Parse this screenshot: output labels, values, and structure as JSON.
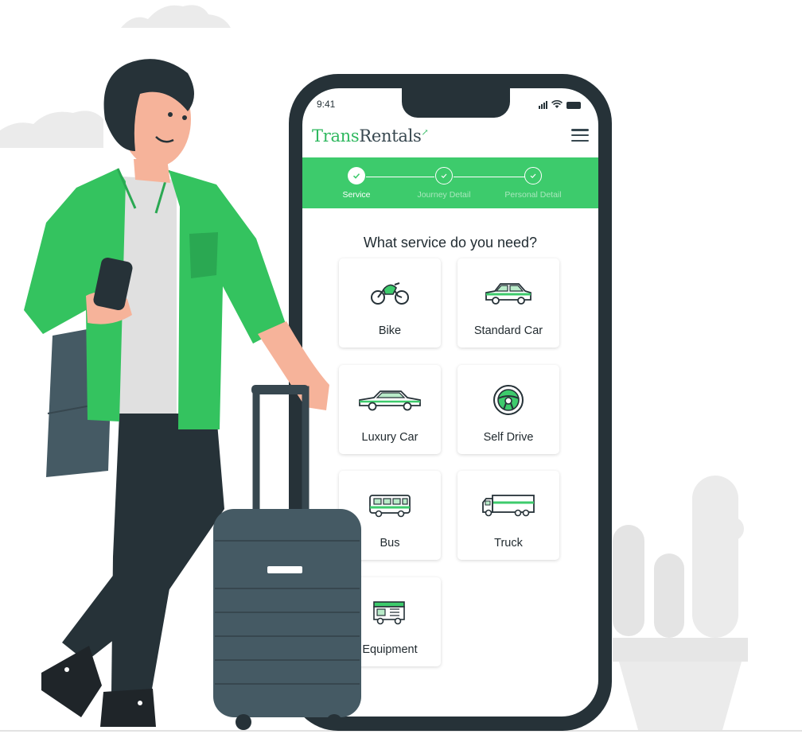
{
  "status_bar": {
    "time": "9:41"
  },
  "brand": {
    "part1": "Trans",
    "part2": "Rentals"
  },
  "header": {
    "menu_icon": "hamburger-menu-icon"
  },
  "stepper": {
    "steps": [
      {
        "label": "Service",
        "state": "done"
      },
      {
        "label": "Journey Detail",
        "state": "pending"
      },
      {
        "label": "Personal Detail",
        "state": "pending"
      }
    ]
  },
  "question": "What service do you need?",
  "services": [
    {
      "label": "Bike",
      "icon": "motorbike-icon"
    },
    {
      "label": "Standard Car",
      "icon": "car-icon"
    },
    {
      "label": "Luxury Car",
      "icon": "luxury-car-icon"
    },
    {
      "label": "Self Drive",
      "icon": "steering-wheel-icon"
    },
    {
      "label": "Bus",
      "icon": "bus-icon"
    },
    {
      "label": "Truck",
      "icon": "truck-icon"
    },
    {
      "label": "Equipment",
      "icon": "equipment-truck-icon"
    }
  ],
  "colors": {
    "brand_green": "#3dcb6c",
    "dark": "#263238",
    "shirt": "#34c35f"
  }
}
